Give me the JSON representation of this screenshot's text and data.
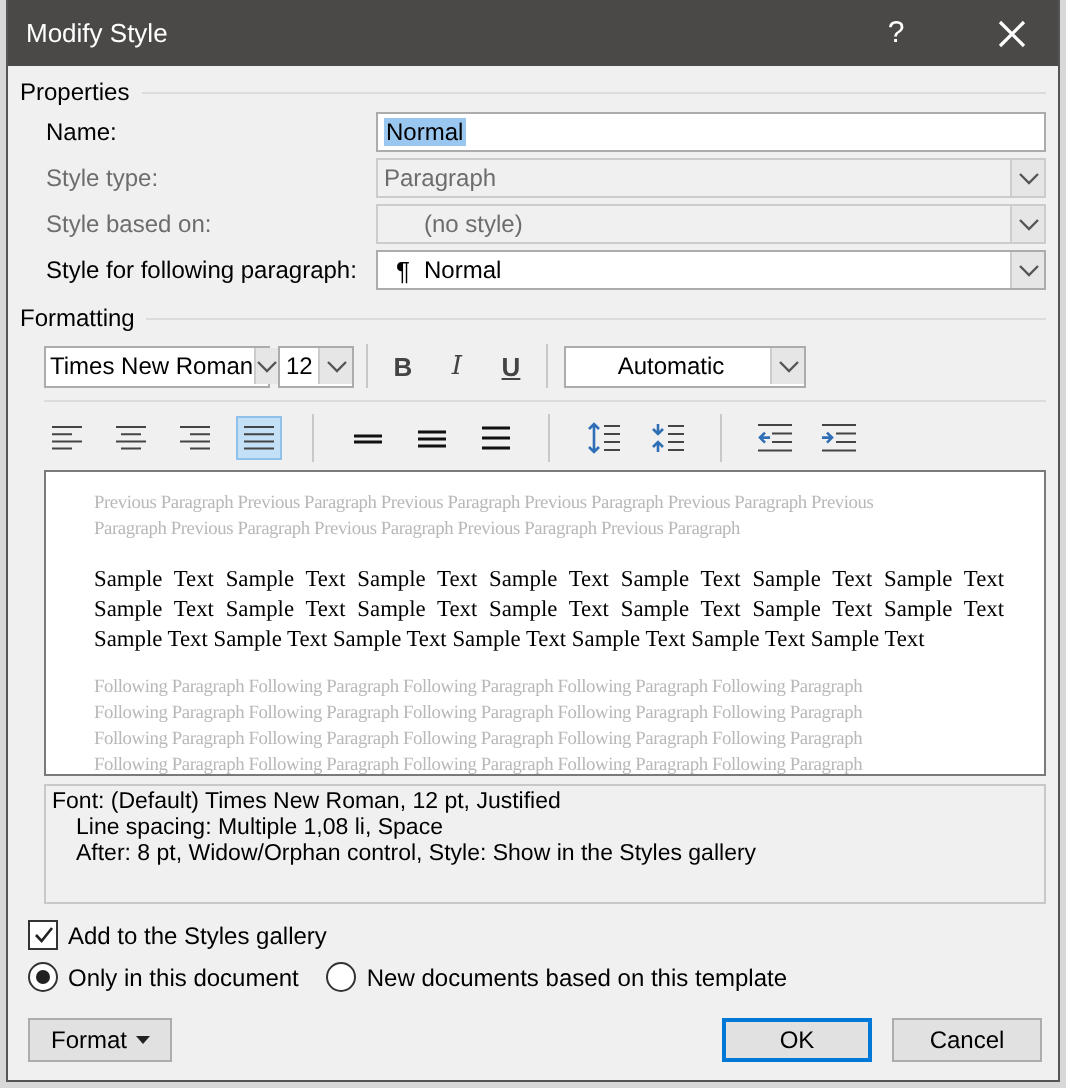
{
  "window": {
    "title": "Modify Style",
    "help": "?"
  },
  "properties": {
    "heading": "Properties",
    "fields": [
      {
        "label": "Name:",
        "kind": "text",
        "value": "Normal",
        "disabled": false,
        "selected": true
      },
      {
        "label": "Style type:",
        "kind": "combo",
        "value": "Paragraph",
        "disabled": true
      },
      {
        "label": "Style based on:",
        "kind": "combo",
        "value": "(no style)",
        "disabled": true
      },
      {
        "label": "Style for following paragraph:",
        "kind": "combo",
        "prefix": "¶",
        "value": "Normal",
        "disabled": false
      }
    ]
  },
  "formatting": {
    "heading": "Formatting",
    "font": "Times New Roman",
    "size": "12",
    "styles": [
      {
        "label": "B",
        "kind": "bold",
        "on": false
      },
      {
        "label": "I",
        "kind": "italic",
        "on": false
      },
      {
        "label": "U",
        "kind": "underline",
        "on": false
      }
    ],
    "font_color_label": "Automatic",
    "paragraph_buttons": [
      {
        "kind": "align-left",
        "selected": false
      },
      {
        "kind": "align-center",
        "selected": false
      },
      {
        "kind": "align-right",
        "selected": false
      },
      {
        "kind": "justify",
        "selected": true
      },
      {
        "kind": "sep"
      },
      {
        "kind": "single",
        "selected": false
      },
      {
        "kind": "one-half",
        "selected": false
      },
      {
        "kind": "double",
        "selected": false
      },
      {
        "kind": "sep"
      },
      {
        "kind": "space-up",
        "selected": false
      },
      {
        "kind": "space-down",
        "selected": false
      },
      {
        "kind": "sep"
      },
      {
        "kind": "outdent",
        "selected": false
      },
      {
        "kind": "indent",
        "selected": false
      }
    ]
  },
  "preview": {
    "previous": [
      "Previous Paragraph Previous Paragraph Previous Paragraph Previous Paragraph Previous Paragraph Previous",
      "Paragraph Previous Paragraph Previous Paragraph Previous Paragraph Previous Paragraph"
    ],
    "sample": [
      "Sample Text Sample Text Sample Text Sample Text Sample Text Sample Text Sample Text",
      "Sample Text Sample Text Sample Text Sample Text Sample Text Sample Text Sample Text",
      "Sample Text Sample Text Sample Text Sample Text Sample Text Sample Text Sample Text"
    ],
    "following": [
      "Following Paragraph Following Paragraph Following Paragraph Following Paragraph Following Paragraph",
      "Following Paragraph Following Paragraph Following Paragraph Following Paragraph Following Paragraph",
      "Following Paragraph Following Paragraph Following Paragraph Following Paragraph Following Paragraph",
      "Following Paragraph Following Paragraph Following Paragraph Following Paragraph Following Paragraph"
    ]
  },
  "description": [
    "Font: (Default) Times New Roman, 12 pt, Justified",
    "Line spacing:  Multiple 1,08 li, Space",
    "After:  8 pt, Widow/Orphan control, Style: Show in the Styles gallery"
  ],
  "add_to_gallery": {
    "label": "Add to the Styles gallery",
    "checked": true
  },
  "scope": [
    {
      "label": "Only in this document",
      "selected": true
    },
    {
      "label": "New documents based on this template",
      "selected": false
    }
  ],
  "buttons": {
    "format": "Format",
    "ok": "OK",
    "cancel": "Cancel"
  }
}
